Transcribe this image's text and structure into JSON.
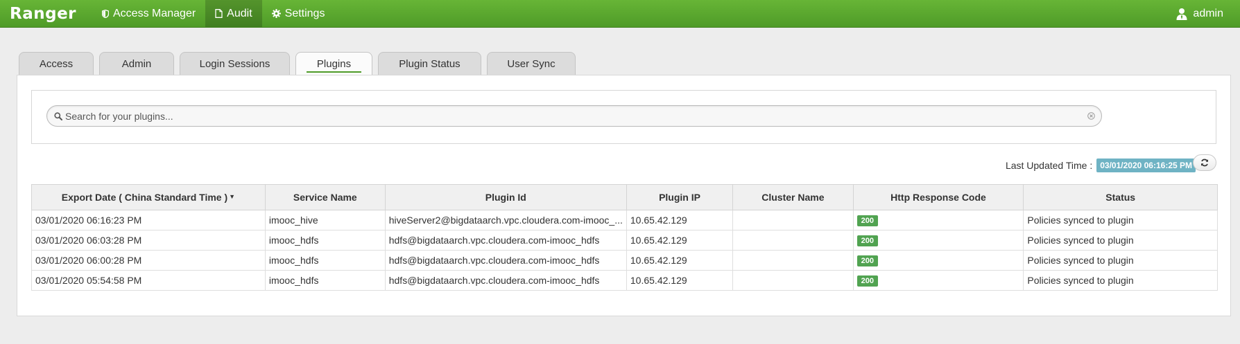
{
  "navbar": {
    "brand": "Ranger",
    "items": [
      {
        "label": "Access Manager",
        "icon": "shield-icon"
      },
      {
        "label": "Audit",
        "icon": "file-icon",
        "active": true
      },
      {
        "label": "Settings",
        "icon": "gear-icon"
      }
    ],
    "user": {
      "label": "admin",
      "icon": "user-icon"
    }
  },
  "tabs": [
    {
      "label": "Access"
    },
    {
      "label": "Admin"
    },
    {
      "label": "Login Sessions"
    },
    {
      "label": "Plugins",
      "active": true
    },
    {
      "label": "Plugin Status"
    },
    {
      "label": "User Sync"
    }
  ],
  "search": {
    "placeholder": "Search for your plugins...",
    "value": ""
  },
  "last_updated": {
    "label": "Last Updated Time :",
    "value": "03/01/2020 06:16:25 PM"
  },
  "table": {
    "columns": [
      "Export Date ( China Standard Time )",
      "Service Name",
      "Plugin Id",
      "Plugin IP",
      "Cluster Name",
      "Http Response Code",
      "Status"
    ],
    "rows": [
      [
        "03/01/2020 06:16:23 PM",
        "imooc_hive",
        "hiveServer2@bigdataarch.vpc.cloudera.com-imooc_...",
        "10.65.42.129",
        "",
        "200",
        "Policies synced to plugin"
      ],
      [
        "03/01/2020 06:03:28 PM",
        "imooc_hdfs",
        "hdfs@bigdataarch.vpc.cloudera.com-imooc_hdfs",
        "10.65.42.129",
        "",
        "200",
        "Policies synced to plugin"
      ],
      [
        "03/01/2020 06:00:28 PM",
        "imooc_hdfs",
        "hdfs@bigdataarch.vpc.cloudera.com-imooc_hdfs",
        "10.65.42.129",
        "",
        "200",
        "Policies synced to plugin"
      ],
      [
        "03/01/2020 05:54:58 PM",
        "imooc_hdfs",
        "hdfs@bigdataarch.vpc.cloudera.com-imooc_hdfs",
        "10.65.42.129",
        "",
        "200",
        "Policies synced to plugin"
      ]
    ]
  },
  "colors": {
    "brand_green": "#5aa82f",
    "badge_success": "#51a351",
    "badge_info": "#6fb3c4"
  }
}
